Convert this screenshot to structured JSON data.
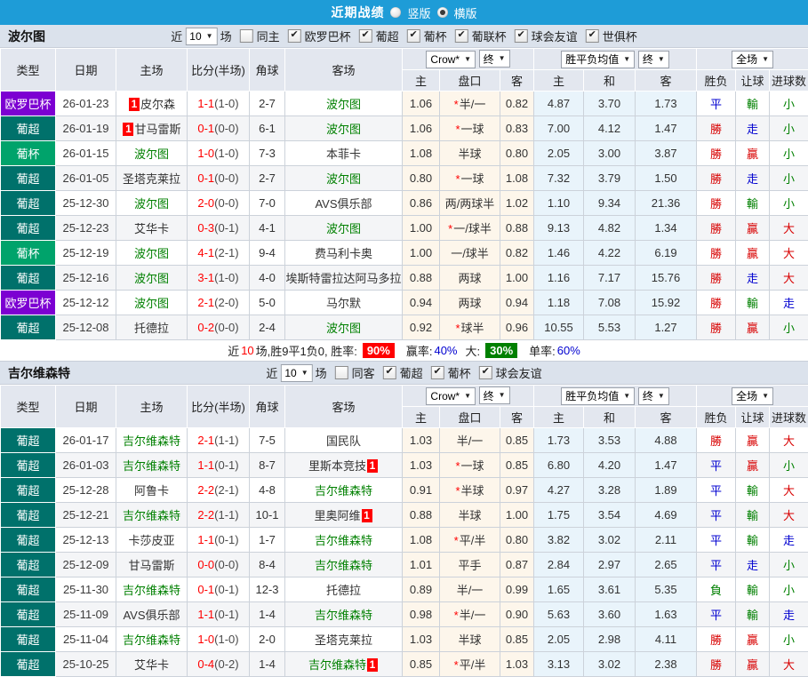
{
  "topbar": {
    "title": "近期战绩",
    "vertical_label": "竖版",
    "horizontal_label": "横版"
  },
  "filter_labels": {
    "near": "近",
    "count": "10",
    "games": "场"
  },
  "table_header": {
    "cols": [
      "类型",
      "日期",
      "主场",
      "比分(半场)",
      "角球",
      "客场"
    ],
    "sub": [
      "主",
      "盘口",
      "客",
      "主",
      "和",
      "客",
      "胜负",
      "让球",
      "进球数"
    ],
    "dropdowns": {
      "bookmaker": "Crow*",
      "final1": "终",
      "avg": "胜平负均值",
      "final2": "终",
      "scope": "全场"
    }
  },
  "colors": {
    "accent_blue": "#1e9cd7",
    "type_colors": {
      "欧罗巴杯": "#7c00d2",
      "葡超": "#00716b",
      "葡杯": "#00a36b"
    },
    "result_colors": {
      "勝": "#d80000",
      "贏": "#d80000",
      "大": "#d80000",
      "平": "#0000d0",
      "走": "#0000d0",
      "負": "#008000",
      "輸": "#008000",
      "小": "#008000"
    }
  },
  "sections": [
    {
      "team": "波尔图",
      "filter": {
        "same_label": "同主",
        "same_checked": false,
        "leagues": [
          "欧罗巴杯",
          "葡超",
          "葡杯",
          "葡联杯",
          "球会友谊",
          "世俱杯"
        ]
      },
      "rows": [
        {
          "type": "欧罗巴杯",
          "date": "26-01-23",
          "home": {
            "name": "皮尔森",
            "badge": "1",
            "badge_pos": "before"
          },
          "score": "1-1",
          "half": "(1-0)",
          "corner": "2-7",
          "away": {
            "name": "波尔图",
            "green": true
          },
          "o1": "1.06",
          "star": true,
          "hc": "半/一",
          "o2": "0.82",
          "aw": "4.87",
          "ad": "3.70",
          "al": "1.73",
          "res": "平",
          "hres": "輸",
          "goals": "小"
        },
        {
          "type": "葡超",
          "date": "26-01-19",
          "home": {
            "name": "甘马雷斯",
            "badge": "1",
            "badge_pos": "before"
          },
          "score": "0-1",
          "half": "(0-0)",
          "corner": "6-1",
          "away": {
            "name": "波尔图",
            "green": true
          },
          "o1": "1.06",
          "star": true,
          "hc": "一球",
          "o2": "0.83",
          "aw": "7.00",
          "ad": "4.12",
          "al": "1.47",
          "res": "勝",
          "hres": "走",
          "goals": "小"
        },
        {
          "type": "葡杯",
          "date": "26-01-15",
          "home": {
            "name": "波尔图",
            "green": true
          },
          "score": "1-0",
          "half": "(1-0)",
          "corner": "7-3",
          "away": {
            "name": "本菲卡"
          },
          "o1": "1.08",
          "star": false,
          "hc": "半球",
          "o2": "0.80",
          "aw": "2.05",
          "ad": "3.00",
          "al": "3.87",
          "res": "勝",
          "hres": "贏",
          "goals": "小"
        },
        {
          "type": "葡超",
          "date": "26-01-05",
          "home": {
            "name": "圣塔克莱拉"
          },
          "score": "0-1",
          "half": "(0-0)",
          "corner": "2-7",
          "away": {
            "name": "波尔图",
            "green": true
          },
          "o1": "0.80",
          "star": true,
          "hc": "一球",
          "o2": "1.08",
          "aw": "7.32",
          "ad": "3.79",
          "al": "1.50",
          "res": "勝",
          "hres": "走",
          "goals": "小"
        },
        {
          "type": "葡超",
          "date": "25-12-30",
          "home": {
            "name": "波尔图",
            "green": true
          },
          "score": "2-0",
          "half": "(0-0)",
          "corner": "7-0",
          "away": {
            "name": "AVS俱乐部"
          },
          "o1": "0.86",
          "star": false,
          "hc": "两/两球半",
          "o2": "1.02",
          "aw": "1.10",
          "ad": "9.34",
          "al": "21.36",
          "res": "勝",
          "hres": "輸",
          "goals": "小"
        },
        {
          "type": "葡超",
          "date": "25-12-23",
          "home": {
            "name": "艾华卡"
          },
          "score": "0-3",
          "half": "(0-1)",
          "corner": "4-1",
          "away": {
            "name": "波尔图",
            "green": true
          },
          "o1": "1.00",
          "star": true,
          "hc": "一/球半",
          "o2": "0.88",
          "aw": "9.13",
          "ad": "4.82",
          "al": "1.34",
          "res": "勝",
          "hres": "贏",
          "goals": "大"
        },
        {
          "type": "葡杯",
          "date": "25-12-19",
          "home": {
            "name": "波尔图",
            "green": true
          },
          "score": "4-1",
          "half": "(2-1)",
          "corner": "9-4",
          "away": {
            "name": "费马利卡奥"
          },
          "o1": "1.00",
          "star": false,
          "hc": "一/球半",
          "o2": "0.82",
          "aw": "1.46",
          "ad": "4.22",
          "al": "6.19",
          "res": "勝",
          "hres": "贏",
          "goals": "大"
        },
        {
          "type": "葡超",
          "date": "25-12-16",
          "home": {
            "name": "波尔图",
            "green": true
          },
          "score": "3-1",
          "half": "(1-0)",
          "corner": "4-0",
          "away": {
            "name": "埃斯特雷拉达阿马多拉"
          },
          "o1": "0.88",
          "star": false,
          "hc": "两球",
          "o2": "1.00",
          "aw": "1.16",
          "ad": "7.17",
          "al": "15.76",
          "res": "勝",
          "hres": "走",
          "goals": "大"
        },
        {
          "type": "欧罗巴杯",
          "date": "25-12-12",
          "home": {
            "name": "波尔图",
            "green": true
          },
          "score": "2-1",
          "half": "(2-0)",
          "corner": "5-0",
          "away": {
            "name": "马尔默"
          },
          "o1": "0.94",
          "star": false,
          "hc": "两球",
          "o2": "0.94",
          "aw": "1.18",
          "ad": "7.08",
          "al": "15.92",
          "res": "勝",
          "hres": "輸",
          "goals": "走"
        },
        {
          "type": "葡超",
          "date": "25-12-08",
          "home": {
            "name": "托德拉"
          },
          "score": "0-2",
          "half": "(0-0)",
          "corner": "2-4",
          "away": {
            "name": "波尔图",
            "green": true
          },
          "o1": "0.92",
          "star": true,
          "hc": "球半",
          "o2": "0.96",
          "aw": "10.55",
          "ad": "5.53",
          "al": "1.27",
          "res": "勝",
          "hres": "贏",
          "goals": "小"
        }
      ],
      "summary": {
        "parts": [
          [
            "近",
            ""
          ],
          [
            "10",
            "red"
          ],
          [
            "场,胜9平1负0, 胜率:",
            ""
          ],
          [
            "90%",
            "box-red"
          ],
          [
            "赢率:",
            "gap"
          ],
          [
            "40%",
            "blue"
          ],
          [
            "大:",
            "gap"
          ],
          [
            "30%",
            "box-green"
          ],
          [
            "单率:",
            "gap"
          ],
          [
            "60%",
            "blue"
          ]
        ]
      }
    },
    {
      "team": "吉尔维森特",
      "filter": {
        "same_label": "同客",
        "same_checked": false,
        "leagues": [
          "葡超",
          "葡杯",
          "球会友谊"
        ]
      },
      "rows": [
        {
          "type": "葡超",
          "date": "26-01-17",
          "home": {
            "name": "吉尔维森特",
            "green": true
          },
          "score": "2-1",
          "half": "(1-1)",
          "corner": "7-5",
          "away": {
            "name": "国民队"
          },
          "o1": "1.03",
          "star": false,
          "hc": "半/一",
          "o2": "0.85",
          "aw": "1.73",
          "ad": "3.53",
          "al": "4.88",
          "res": "勝",
          "hres": "贏",
          "goals": "大"
        },
        {
          "type": "葡超",
          "date": "26-01-03",
          "home": {
            "name": "吉尔维森特",
            "green": true
          },
          "score": "1-1",
          "half": "(0-1)",
          "corner": "8-7",
          "away": {
            "name": "里斯本竞技",
            "badge": "1",
            "badge_pos": "after"
          },
          "o1": "1.03",
          "star": true,
          "hc": "一球",
          "o2": "0.85",
          "aw": "6.80",
          "ad": "4.20",
          "al": "1.47",
          "res": "平",
          "hres": "贏",
          "goals": "小"
        },
        {
          "type": "葡超",
          "date": "25-12-28",
          "home": {
            "name": "阿鲁卡"
          },
          "score": "2-2",
          "half": "(2-1)",
          "corner": "4-8",
          "away": {
            "name": "吉尔维森特",
            "green": true
          },
          "o1": "0.91",
          "star": true,
          "hc": "半球",
          "o2": "0.97",
          "aw": "4.27",
          "ad": "3.28",
          "al": "1.89",
          "res": "平",
          "hres": "輸",
          "goals": "大"
        },
        {
          "type": "葡超",
          "date": "25-12-21",
          "home": {
            "name": "吉尔维森特",
            "green": true
          },
          "score": "2-2",
          "half": "(1-1)",
          "corner": "10-1",
          "away": {
            "name": "里奥阿维",
            "badge": "1",
            "badge_pos": "after"
          },
          "o1": "0.88",
          "star": false,
          "hc": "半球",
          "o2": "1.00",
          "aw": "1.75",
          "ad": "3.54",
          "al": "4.69",
          "res": "平",
          "hres": "輸",
          "goals": "大"
        },
        {
          "type": "葡超",
          "date": "25-12-13",
          "home": {
            "name": "卡莎皮亚"
          },
          "score": "1-1",
          "half": "(0-1)",
          "corner": "1-7",
          "away": {
            "name": "吉尔维森特",
            "green": true
          },
          "o1": "1.08",
          "star": true,
          "hc": "平/半",
          "o2": "0.80",
          "aw": "3.82",
          "ad": "3.02",
          "al": "2.11",
          "res": "平",
          "hres": "輸",
          "goals": "走"
        },
        {
          "type": "葡超",
          "date": "25-12-09",
          "home": {
            "name": "甘马雷斯"
          },
          "score": "0-0",
          "half": "(0-0)",
          "corner": "8-4",
          "away": {
            "name": "吉尔维森特",
            "green": true
          },
          "o1": "1.01",
          "star": false,
          "hc": "平手",
          "o2": "0.87",
          "aw": "2.84",
          "ad": "2.97",
          "al": "2.65",
          "res": "平",
          "hres": "走",
          "goals": "小"
        },
        {
          "type": "葡超",
          "date": "25-11-30",
          "home": {
            "name": "吉尔维森特",
            "green": true
          },
          "score": "0-1",
          "half": "(0-1)",
          "corner": "12-3",
          "away": {
            "name": "托德拉"
          },
          "o1": "0.89",
          "star": false,
          "hc": "半/一",
          "o2": "0.99",
          "aw": "1.65",
          "ad": "3.61",
          "al": "5.35",
          "res": "負",
          "hres": "輸",
          "goals": "小"
        },
        {
          "type": "葡超",
          "date": "25-11-09",
          "home": {
            "name": "AVS俱乐部"
          },
          "score": "1-1",
          "half": "(0-1)",
          "corner": "1-4",
          "away": {
            "name": "吉尔维森特",
            "green": true
          },
          "o1": "0.98",
          "star": true,
          "hc": "半/一",
          "o2": "0.90",
          "aw": "5.63",
          "ad": "3.60",
          "al": "1.63",
          "res": "平",
          "hres": "輸",
          "goals": "走"
        },
        {
          "type": "葡超",
          "date": "25-11-04",
          "home": {
            "name": "吉尔维森特",
            "green": true
          },
          "score": "1-0",
          "half": "(1-0)",
          "corner": "2-0",
          "away": {
            "name": "圣塔克莱拉"
          },
          "o1": "1.03",
          "star": false,
          "hc": "半球",
          "o2": "0.85",
          "aw": "2.05",
          "ad": "2.98",
          "al": "4.11",
          "res": "勝",
          "hres": "贏",
          "goals": "小"
        },
        {
          "type": "葡超",
          "date": "25-10-25",
          "home": {
            "name": "艾华卡"
          },
          "score": "0-4",
          "half": "(0-2)",
          "corner": "1-4",
          "away": {
            "name": "吉尔维森特",
            "green": true,
            "badge": "1",
            "badge_pos": "after"
          },
          "o1": "0.85",
          "star": true,
          "hc": "平/半",
          "o2": "1.03",
          "aw": "3.13",
          "ad": "3.02",
          "al": "2.38",
          "res": "勝",
          "hres": "贏",
          "goals": "大"
        }
      ]
    }
  ]
}
